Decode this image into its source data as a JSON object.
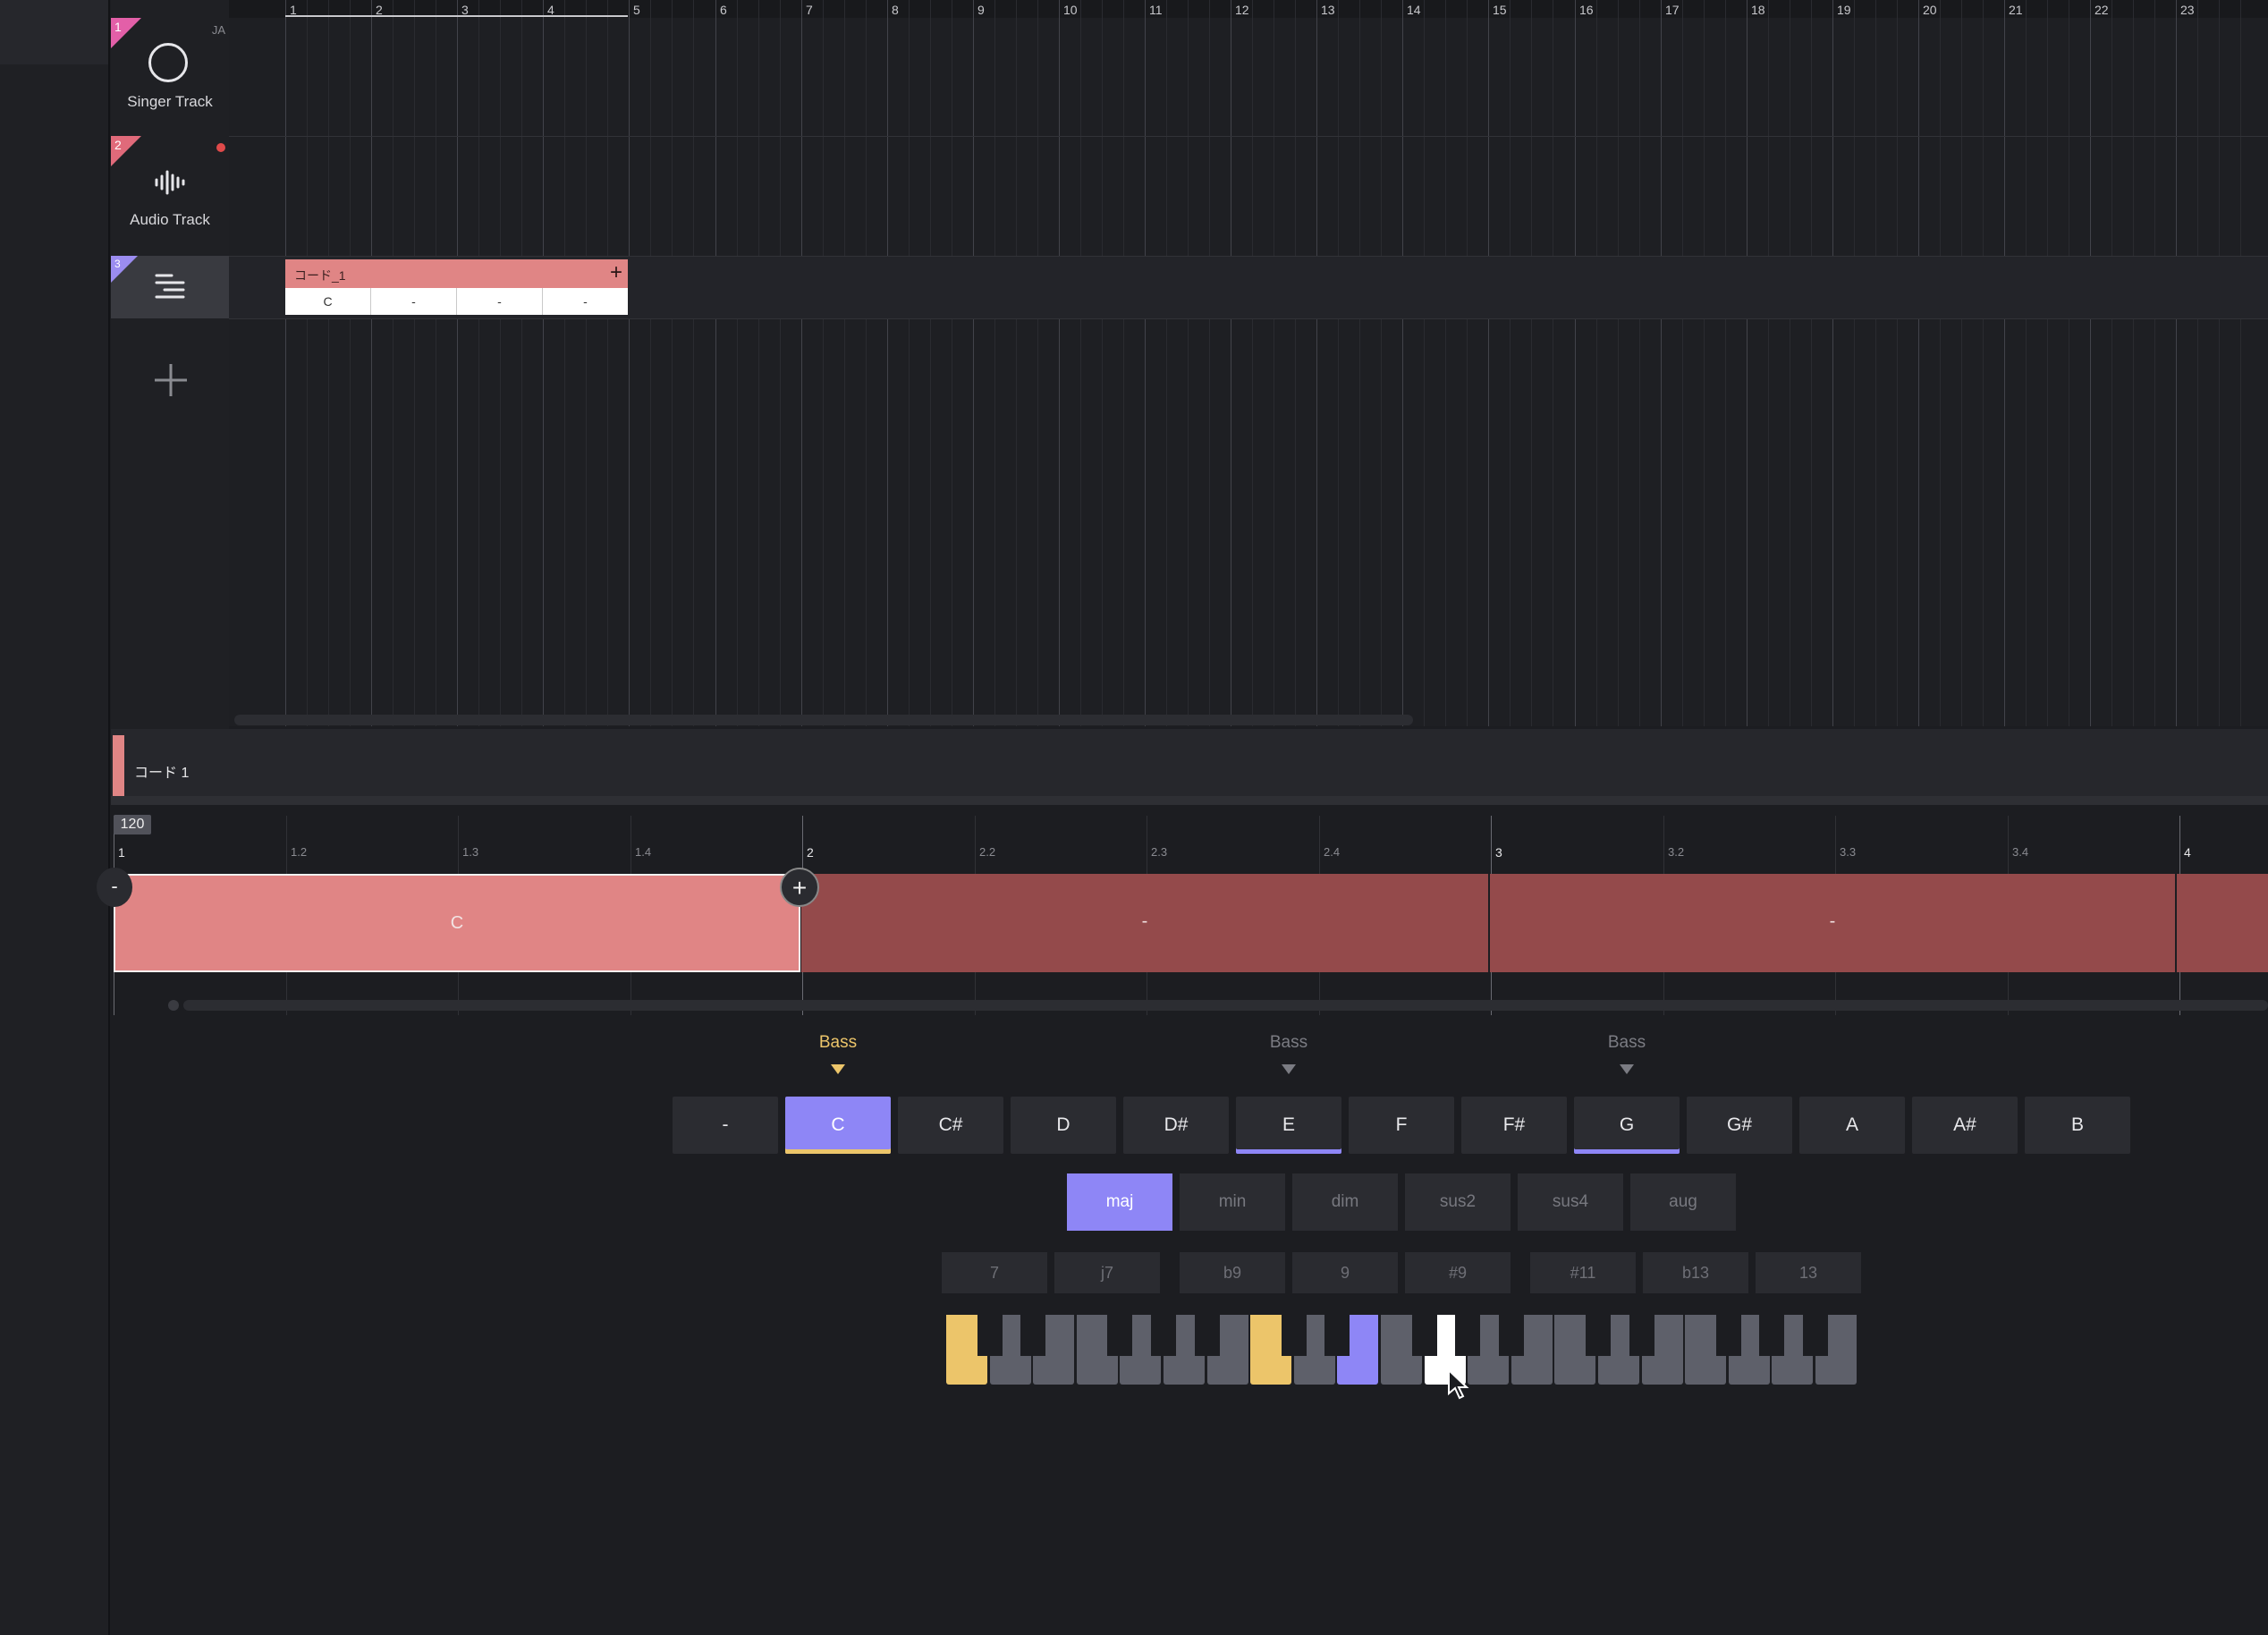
{
  "colors": {
    "accent": "#8e86f6",
    "bass_accent": "#ecc56a",
    "region": "#e08585",
    "region_dark": "#944a4b",
    "track_pink": "#e35fa8"
  },
  "tracks": [
    {
      "num": "1",
      "lang": "JA",
      "label": "Singer Track",
      "icon": "circle-icon"
    },
    {
      "num": "2",
      "label": "Audio Track",
      "icon": "waveform-icon"
    },
    {
      "num": "3",
      "label": "",
      "icon": "chord-track-icon"
    }
  ],
  "add_track_icon": "plus-icon",
  "ruler": [
    "1",
    "2",
    "3",
    "4",
    "5",
    "6",
    "7",
    "8",
    "9",
    "10",
    "11",
    "12",
    "13",
    "14",
    "15",
    "16",
    "17",
    "18",
    "19",
    "20",
    "21",
    "22",
    "23"
  ],
  "region": {
    "name": "コード_1",
    "cells": [
      "C",
      "-",
      "-",
      "-"
    ]
  },
  "editor": {
    "title": "コード 1",
    "tempo": "120",
    "ruler": [
      {
        "t": "1"
      },
      {
        "t": "1.2"
      },
      {
        "t": "1.3"
      },
      {
        "t": "1.4"
      },
      {
        "t": "2"
      },
      {
        "t": "2.2"
      },
      {
        "t": "2.3"
      },
      {
        "t": "2.4"
      },
      {
        "t": "3"
      },
      {
        "t": "3.2"
      },
      {
        "t": "3.3"
      },
      {
        "t": "3.4"
      },
      {
        "t": "4"
      }
    ],
    "chords": [
      "C",
      "-",
      "-"
    ]
  },
  "picker": {
    "bass": [
      {
        "label": "Bass"
      },
      {
        "label": "Bass"
      },
      {
        "label": "Bass"
      }
    ],
    "notes": [
      "-",
      "C",
      "C#",
      "D",
      "D#",
      "E",
      "F",
      "F#",
      "G",
      "G#",
      "A",
      "A#",
      "B"
    ],
    "selected_note": "C",
    "chord_tones": [
      "E",
      "G"
    ],
    "qualities": [
      "maj",
      "min",
      "dim",
      "sus2",
      "sus4",
      "aug"
    ],
    "selected_quality": "maj",
    "extensions": [
      "7",
      "j7",
      "b9",
      "9",
      "#9",
      "#11",
      "b13",
      "13"
    ]
  }
}
